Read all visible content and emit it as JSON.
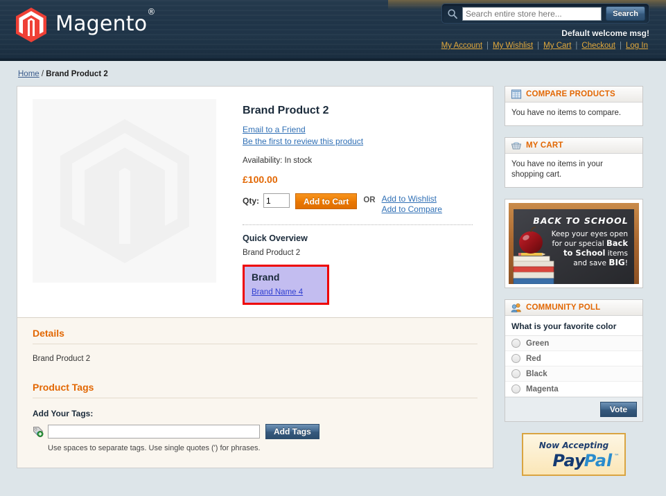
{
  "header": {
    "logo_text": "Magento",
    "logo_trademark": "®",
    "logo_icon": "magento-logo-icon",
    "search": {
      "icon": "search-icon",
      "placeholder": "Search entire store here...",
      "value": "",
      "button_label": "Search"
    },
    "welcome_message": "Default welcome msg!",
    "links": [
      {
        "label": "My Account"
      },
      {
        "label": "My Wishlist"
      },
      {
        "label": "My Cart"
      },
      {
        "label": "Checkout"
      },
      {
        "label": "Log In"
      }
    ],
    "link_separator": "|"
  },
  "breadcrumb": {
    "home_label": "Home",
    "separator": "/",
    "current": "Brand Product 2"
  },
  "product": {
    "image_placeholder_icon": "magento-placeholder-icon",
    "title": "Brand Product 2",
    "email_friend_label": "Email to a Friend",
    "review_label": "Be the first to review this product",
    "availability_label": "Availability:",
    "availability_value": "In stock",
    "availability_text": "Availability: In stock",
    "price": "£100.00",
    "qty_label": "Qty:",
    "qty_value": "1",
    "add_to_cart_label": "Add to Cart",
    "or_label": "OR",
    "add_to_wishlist_label": "Add to Wishlist",
    "add_to_compare_label": "Add to Compare",
    "quick_overview_title": "Quick Overview",
    "quick_overview_text": "Brand Product 2",
    "brand_box": {
      "heading": "Brand",
      "link_label": "Brand Name 4",
      "highlight_border_color": "#ee0000",
      "highlight_background_color": "#c3bdf0"
    }
  },
  "collateral": {
    "details_title": "Details",
    "details_text": "Brand Product 2",
    "tags_title": "Product Tags",
    "add_tags_label": "Add Your Tags:",
    "tag_icon": "tag-add-icon",
    "tag_input_value": "",
    "add_tags_button": "Add Tags",
    "tags_note": "Use spaces to separate tags. Use single quotes (') for phrases."
  },
  "sidebar": {
    "compare": {
      "icon": "compare-grid-icon",
      "title": "COMPARE PRODUCTS",
      "body": "You have no items to compare."
    },
    "cart": {
      "icon": "shopping-basket-icon",
      "title": "MY CART",
      "body": "You have no items in your shopping cart."
    },
    "banner": {
      "icon": "back-to-school-banner",
      "headline": "BACK TO SCHOOL",
      "line1": "Keep your eyes open",
      "line2": "for our special",
      "line2_bold": "Back",
      "line3_bold": "to School",
      "line3": "items",
      "line4": "and save",
      "line4_bold": "BIG",
      "line4_end": "!"
    },
    "poll": {
      "icon": "community-poll-icon",
      "title": "COMMUNITY POLL",
      "question": "What is your favorite color",
      "options": [
        {
          "label": "Green"
        },
        {
          "label": "Red"
        },
        {
          "label": "Black"
        },
        {
          "label": "Magenta"
        }
      ],
      "vote_button": "Vote"
    },
    "paypal": {
      "icon": "paypal-badge-icon",
      "line1": "Now Accepting",
      "brand_pay": "Pay",
      "brand_pal": "Pal",
      "trademark": "™"
    }
  },
  "colors": {
    "accent_orange": "#e26703",
    "link_blue": "#2f6fb5",
    "header_navy": "#1e3448",
    "page_background": "#dde5e9",
    "collateral_background": "#faf6ef"
  }
}
